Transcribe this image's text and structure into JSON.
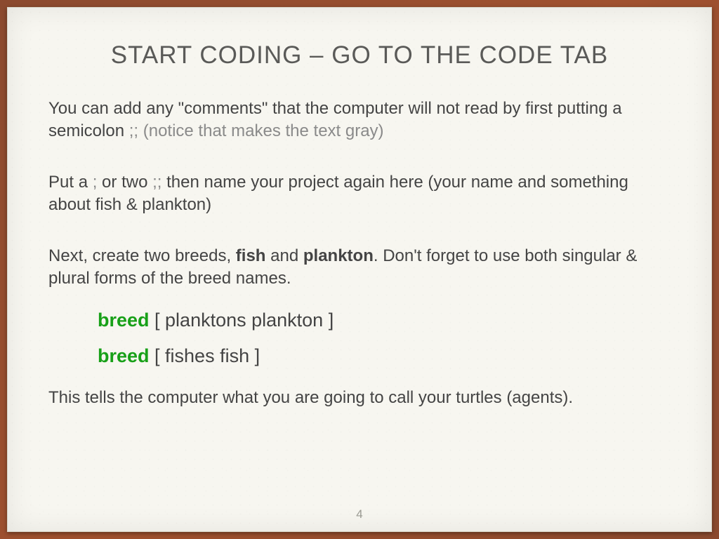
{
  "title": "START CODING – GO TO THE CODE TAB",
  "p1": {
    "a": "You can add any \"comments\" that the computer will not read by first putting a semicolon ",
    "semi": ";;",
    "b": " (notice that makes the text gray)"
  },
  "p2": {
    "a": "Put a ",
    "s1": ";",
    "b": " or two ",
    "s2": ";;",
    "c": " then name your project again here (your name and something about fish & plankton)"
  },
  "p3": {
    "a": "Next, create two breeds, ",
    "fish": "fish",
    "b": " and ",
    "plankton": "plankton",
    "c": ".  Don't forget to use both singular & plural forms of the breed names."
  },
  "code": {
    "kw": "breed",
    "line1": " [ planktons plankton  ]",
    "line2": " [ fishes fish  ]"
  },
  "p4": "This tells the computer what you are going to call your turtles (agents).",
  "pageNumber": "4"
}
